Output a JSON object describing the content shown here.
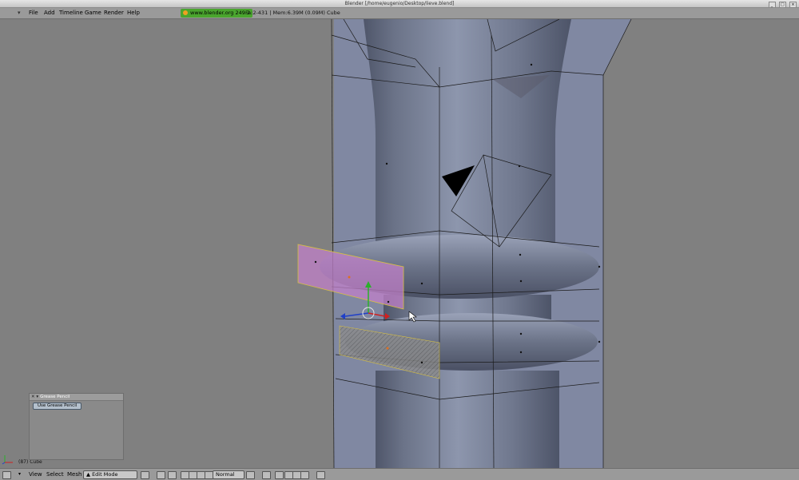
{
  "window": {
    "title": "Blender [/home/eugenio/Desktop/lieve.blend]",
    "buttons": [
      "_",
      "□",
      "×"
    ]
  },
  "menu": {
    "items": [
      "File",
      "Add",
      "Timeline",
      "Game",
      "Render",
      "Help"
    ],
    "website": "www.blender.org 249.2",
    "stats": "Fa:2-431 | Mem:6.39M (0.09M) Cube"
  },
  "viewport": {
    "object_label": "(87) Cube"
  },
  "grease_pencil": {
    "title": "Grease Pencil",
    "button": "Use Grease Pencil"
  },
  "header": {
    "menus": [
      "View",
      "Select",
      "Mesh"
    ],
    "mode": "Edit Mode",
    "pivot": "Normal"
  },
  "colors": {
    "background": "#808080",
    "mesh_fill": "#8088a2",
    "selected_face": "#c080c8",
    "website_badge": "#4aa52e"
  },
  "icons": {
    "mode": "triangle-icon",
    "window_menu": "chevron-down-icon"
  }
}
